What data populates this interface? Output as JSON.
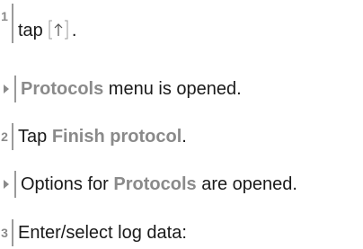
{
  "steps": [
    {
      "number": "1",
      "prefix": "tap",
      "icon": "arrow-up-in-brackets-icon",
      "suffix": "."
    },
    {
      "result_prefix": "",
      "result_highlight": "Protocols",
      "result_suffix": " menu is opened."
    },
    {
      "number": "2",
      "prefix": "Tap ",
      "highlight": "Finish protocol",
      "suffix": "."
    },
    {
      "result_prefix": "Options for ",
      "result_highlight": "Protocols",
      "result_suffix": " are opened."
    },
    {
      "number": "3",
      "text": "Enter/select log data:"
    }
  ],
  "colors": {
    "text": "#1a1a1a",
    "accent_gray": "#8a8a8a",
    "bar": "#9a9a9a"
  }
}
